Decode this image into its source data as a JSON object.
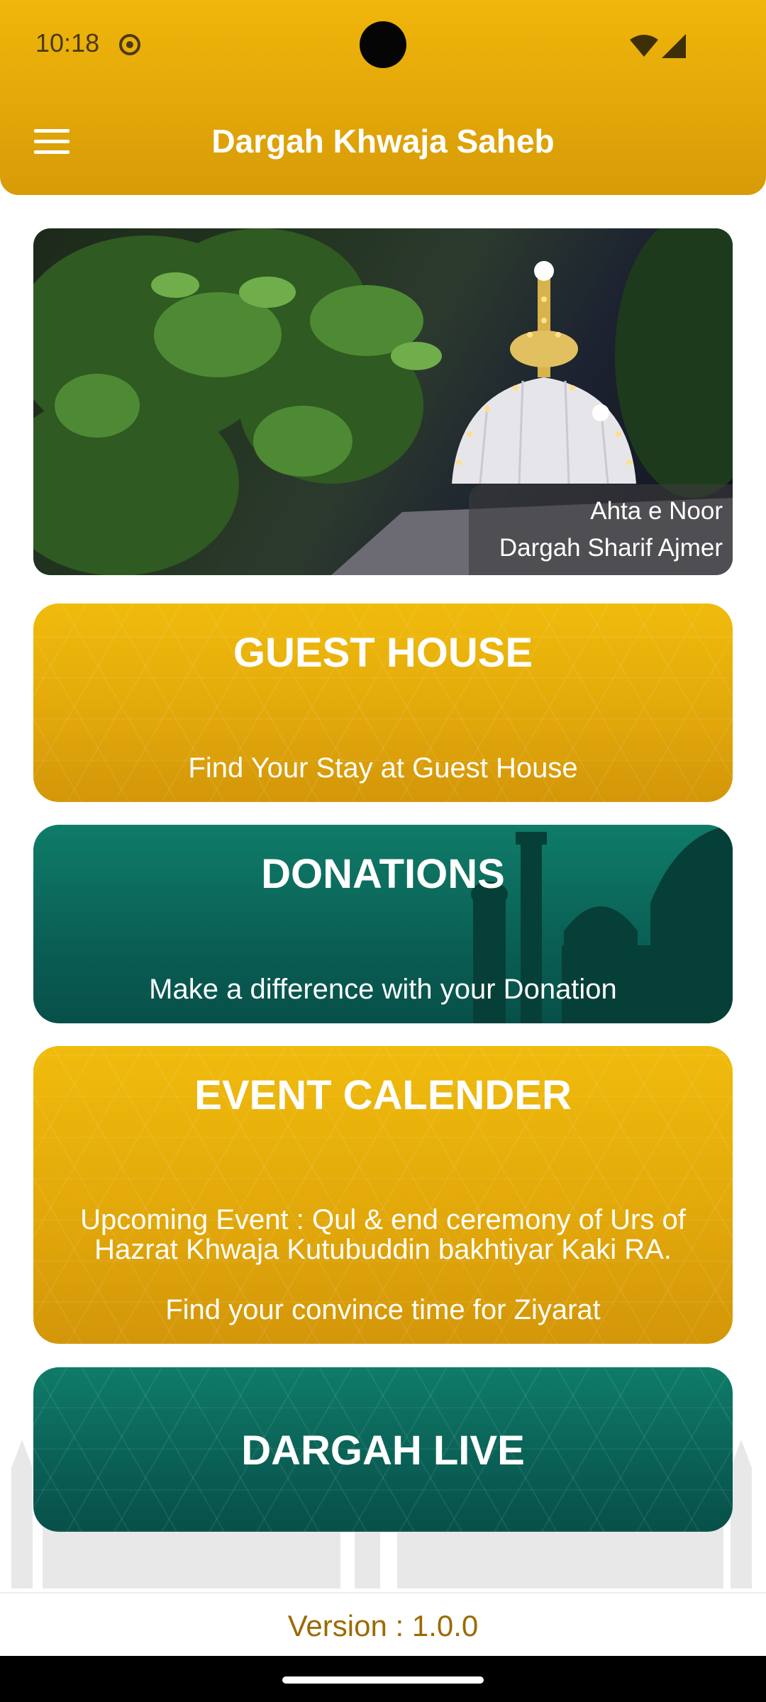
{
  "status_bar": {
    "time": "10:18"
  },
  "app_bar": {
    "title": "Dargah Khwaja Saheb"
  },
  "banner": {
    "caption_line1": "Ahta e Noor",
    "caption_line2": "Dargah Sharif Ajmer"
  },
  "cards": {
    "guest_house": {
      "title": "GUEST HOUSE",
      "subtitle": "Find Your Stay at Guest House"
    },
    "donations": {
      "title": "DONATIONS",
      "subtitle": "Make a difference with your Donation"
    },
    "event_calendar": {
      "title": "EVENT CALENDER",
      "event_line1": "Upcoming Event : Qul & end ceremony of Urs of",
      "event_line2": "Hazrat Khwaja Kutubuddin bakhtiyar Kaki RA.",
      "subtitle": "Find your convince time for Ziyarat"
    },
    "dargah_live": {
      "title": "DARGAH LIVE"
    }
  },
  "footer": {
    "version": "Version : 1.0.0"
  },
  "colors": {
    "gold": "#e6ab0a",
    "green": "#0a6a5c",
    "version_text": "#9c6a00"
  }
}
